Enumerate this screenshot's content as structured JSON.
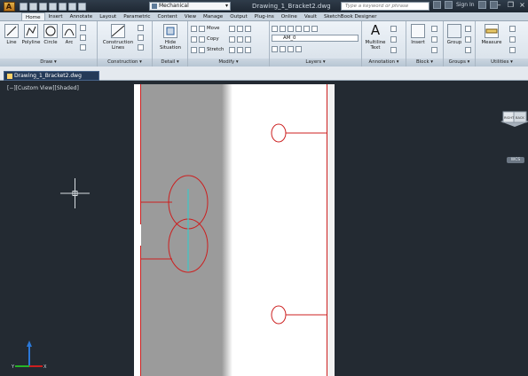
{
  "titlebar": {
    "app_letter": "A",
    "workspace": "Mechanical",
    "document_title": "Drawing_1_Bracket2.dwg",
    "search_placeholder": "Type a keyword or phrase",
    "sign_in": "Sign In"
  },
  "tabs": [
    "Home",
    "Insert",
    "Annotate",
    "Layout",
    "Parametric",
    "Content",
    "View",
    "Manage",
    "Output",
    "Plug-ins",
    "Online",
    "Vault",
    "SketchBook Designer"
  ],
  "active_tab": "Home",
  "ribbon": {
    "draw": {
      "title": "Draw",
      "line": "Line",
      "polyline": "Polyline",
      "circle": "Circle",
      "arc": "Arc"
    },
    "construction": {
      "title": "Construction",
      "lines_1": "Construction",
      "lines_2": "Lines"
    },
    "detail": {
      "title": "Detail",
      "hide_1": "Hide",
      "hide_2": "Situation"
    },
    "modify": {
      "title": "Modify",
      "move": "Move",
      "copy": "Copy",
      "stretch": "Stretch"
    },
    "layers": {
      "title": "Layers",
      "current_layer": "AM_0"
    },
    "annotation": {
      "title": "Annotation",
      "mtext_1": "Multiline",
      "mtext_2": "Text"
    },
    "block": {
      "title": "Block",
      "insert": "Insert"
    },
    "groups": {
      "title": "Groups",
      "group": "Group"
    },
    "utilities": {
      "title": "Utilities",
      "measure": "Measure"
    }
  },
  "drawing_tab": "Drawing_1_Bracket2.dwg",
  "viewport": {
    "label": "[−][Custom View][Shaded]",
    "viewcube_faces": [
      "RIGHT",
      "BACK"
    ],
    "wcs_label": "WCS",
    "ucs_x": "X",
    "ucs_y": "Y"
  },
  "colors": {
    "canvas": "#232a32",
    "sheet_white": "#ffffff",
    "shaded_strip": "#9b9b9b",
    "red_lines": "#cc1f1f",
    "cyan_center": "#3cc8c8",
    "ucs_blue": "#2b78d8",
    "ucs_green": "#28b428",
    "ribbon_bg": "#e4ebf2"
  },
  "icons": [
    "application-menu-icon",
    "new-icon",
    "open-icon",
    "save-icon",
    "undo-icon",
    "redo-icon",
    "plot-icon",
    "search-icon",
    "help-icon",
    "minimize-icon",
    "restore-icon",
    "close-icon",
    "line-icon",
    "polyline-icon",
    "circle-icon",
    "arc-icon",
    "construction-lines-icon",
    "hide-situation-icon",
    "move-icon",
    "copy-icon",
    "stretch-icon",
    "rotate-icon",
    "trim-icon",
    "mirror-icon",
    "layer-properties-icon",
    "multiline-text-icon",
    "insert-block-icon",
    "group-icon",
    "measure-icon",
    "viewcube-icon",
    "crosshair-icon",
    "ucs-icon"
  ]
}
